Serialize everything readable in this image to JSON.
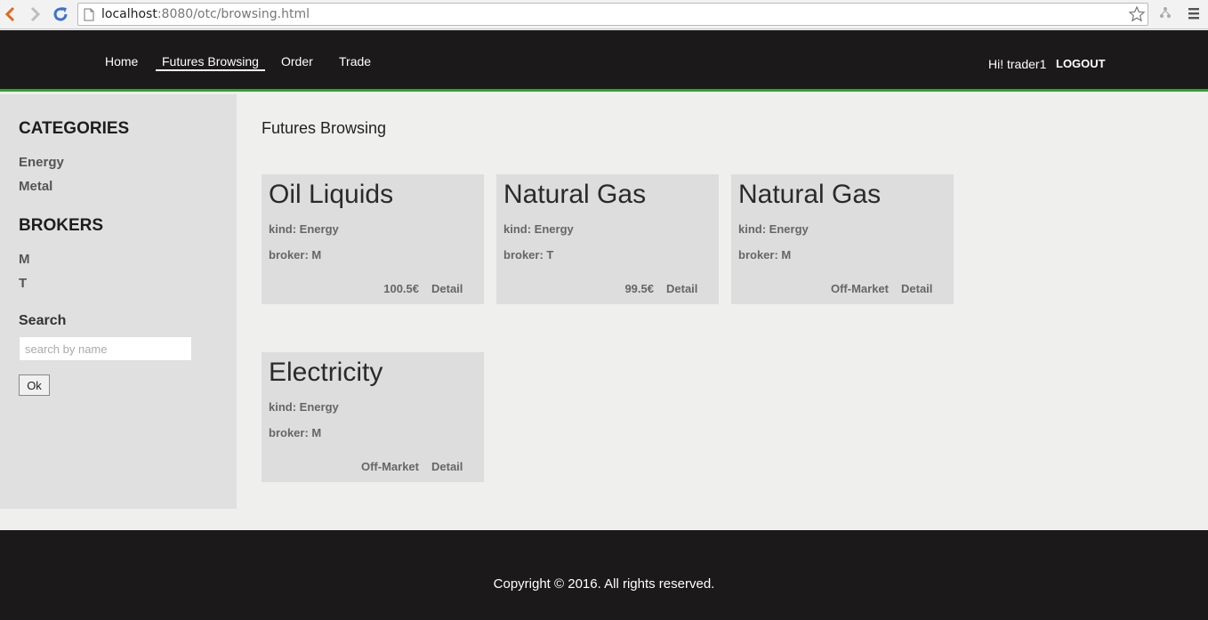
{
  "browser": {
    "url_host": "localhost",
    "url_rest": ":8080/otc/browsing.html"
  },
  "header": {
    "nav": [
      "Home",
      "Futures Browsing",
      "Order",
      "Trade"
    ],
    "active_nav": "Futures Browsing",
    "greeting": "Hi! trader1",
    "logout": "LOGOUT"
  },
  "sidebar": {
    "categories_heading": "CATEGORIES",
    "categories": [
      "Energy",
      "Metal"
    ],
    "brokers_heading": "BROKERS",
    "brokers": [
      "M",
      "T"
    ],
    "search_heading": "Search",
    "search_placeholder": "search by name",
    "ok_label": "Ok"
  },
  "main": {
    "title": "Futures Browsing",
    "cards": [
      {
        "name": "Oil Liquids",
        "kind": "kind: Energy",
        "broker": "broker: M",
        "price": "100.5€",
        "detail": "Detail"
      },
      {
        "name": "Natural Gas",
        "kind": "kind: Energy",
        "broker": "broker: T",
        "price": "99.5€",
        "detail": "Detail"
      },
      {
        "name": "Natural Gas",
        "kind": "kind: Energy",
        "broker": "broker: M",
        "price": "Off-Market",
        "detail": "Detail"
      },
      {
        "name": "Electricity",
        "kind": "kind: Energy",
        "broker": "broker: M",
        "price": "Off-Market",
        "detail": "Detail"
      }
    ]
  },
  "footer": {
    "copyright": "Copyright © 2016. All rights reserved."
  },
  "colors": {
    "header_bg": "#1b191a",
    "accent_green": "#2aa52a",
    "sidebar_bg": "#e0e0e0",
    "card_bg": "#dddddd"
  }
}
